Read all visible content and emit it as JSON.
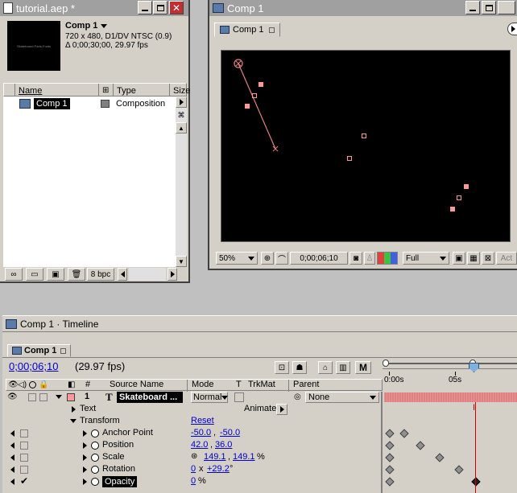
{
  "project": {
    "title": "tutorial.aep *",
    "comp_name": "Comp 1",
    "comp_info_line1": "720 x 480, D1/DV NTSC (0.9)",
    "comp_info_line2": "Δ 0;00;30;00, 29.97 fps",
    "thumb_text": "Skateboard Parts Fonts",
    "col_name": "Name",
    "col_type": "Type",
    "col_size": "Size",
    "item_name": "Comp 1",
    "item_type": "Composition",
    "bpc": "8 bpc"
  },
  "comp_window": {
    "title": "Comp 1",
    "tab": "Comp 1",
    "zoom": "50%",
    "timecode": "0;00;06;10",
    "resolution": "Full",
    "active_label": "Act"
  },
  "timeline": {
    "title": "Comp 1 · Timeline",
    "tab": "Comp 1",
    "current_time": "0;00;06;10",
    "fps": "(29.97 fps)",
    "headers": {
      "num": "#",
      "source": "Source Name",
      "mode": "Mode",
      "t": "T",
      "trkmat": "TrkMat",
      "parent": "Parent"
    },
    "ruler": {
      "start": "0:00s",
      "mid": "05s"
    },
    "layer": {
      "num": "1",
      "name": "Skateboard ...",
      "mode": "Normal",
      "parent": "None"
    },
    "text_group": "Text",
    "animate_label": "Animate:",
    "transform_group": "Transform",
    "reset_label": "Reset",
    "properties": [
      {
        "name": "Anchor Point",
        "v1": "-50.0",
        "sep": ",",
        "v2": "-50.0",
        "unit": ""
      },
      {
        "name": "Position",
        "v1": "42.0",
        "sep": ",",
        "v2": "36.0",
        "unit": ""
      },
      {
        "name": "Scale",
        "v1": "149.1",
        "sep": ",",
        "v2": "149.1",
        "unit": "%"
      },
      {
        "name": "Rotation",
        "v1": "0",
        "sep": "x",
        "v2": "+29.2",
        "unit": "°"
      },
      {
        "name": "Opacity",
        "v1": "0",
        "sep": "",
        "v2": "",
        "unit": "%"
      }
    ],
    "colors": {
      "layer_bar": "#e08080",
      "time_indicator": "#cc0000",
      "label": "#ff9999"
    }
  }
}
